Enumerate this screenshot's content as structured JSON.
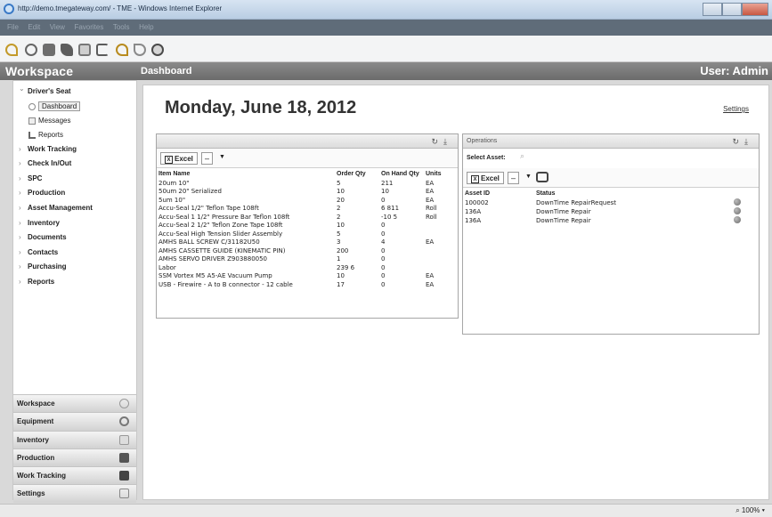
{
  "browser": {
    "title": "http://demo.tmegateway.com/ - TME - Windows Internet Explorer",
    "menu": [
      "File",
      "Edit",
      "View",
      "Favorites",
      "Tools",
      "Help"
    ],
    "zoom": "100%"
  },
  "header": {
    "workspace": "Workspace",
    "page": "Dashboard",
    "user": "User: Admin"
  },
  "sidebar": {
    "tree": [
      {
        "label": "Driver's Seat",
        "open": true,
        "children": [
          {
            "label": "Dashboard",
            "selected": true
          },
          {
            "label": "Messages"
          },
          {
            "label": "Reports"
          }
        ]
      },
      {
        "label": "Work Tracking"
      },
      {
        "label": "Check In/Out"
      },
      {
        "label": "SPC"
      },
      {
        "label": "Production"
      },
      {
        "label": "Asset Management"
      },
      {
        "label": "Inventory"
      },
      {
        "label": "Documents"
      },
      {
        "label": "Contacts"
      },
      {
        "label": "Purchasing"
      },
      {
        "label": "Reports"
      }
    ],
    "accordion": [
      "Workspace",
      "Equipment",
      "Inventory",
      "Production",
      "Work Tracking",
      "Settings"
    ]
  },
  "main": {
    "date": "Monday, June 18, 2012",
    "settings_link": "Settings"
  },
  "inventory_panel": {
    "excel_label": "Excel",
    "columns": [
      "Item Name",
      "Order Qty",
      "On Hand Qty",
      "Units"
    ],
    "rows": [
      [
        "20um 10\"",
        "5",
        "211",
        "EA"
      ],
      [
        "50um 20\" Serialized",
        "10",
        "10",
        "EA"
      ],
      [
        "5um 10\"",
        "20",
        "0",
        "EA"
      ],
      [
        "Accu-Seal 1/2\" Teflon Tape 108ft",
        "2",
        "6 811",
        "Roll"
      ],
      [
        "Accu-Seal 1 1/2\" Pressure Bar Teflon 108ft",
        "2",
        "-10 5",
        "Roll"
      ],
      [
        "Accu-Seal 2 1/2\" Teflon Zone Tape 108ft",
        "10",
        "0",
        ""
      ],
      [
        "Accu-Seal High Tension Slider Assembly",
        "5",
        "0",
        ""
      ],
      [
        "AMHS BALL SCREW C/31182U50",
        "3",
        "4",
        "EA"
      ],
      [
        "AMHS CASSETTE GUIDE (KINEMATIC PIN)",
        "200",
        "0",
        ""
      ],
      [
        "AMHS SERVO DRIVER Z903880050",
        "1",
        "0",
        ""
      ],
      [
        "Labor",
        "239 6",
        "0",
        ""
      ],
      [
        "SSM Vortex M5 A5-AE Vacuum Pump",
        "10",
        "0",
        "EA"
      ],
      [
        "USB - Firewire - A to B connector - 12 cable",
        "17",
        "0",
        "EA"
      ]
    ]
  },
  "operations_panel": {
    "title": "Operations",
    "select_asset_label": "Select Asset:",
    "excel_label": "Excel",
    "columns": [
      "Asset ID",
      "Status"
    ],
    "rows": [
      [
        "100002",
        "DownTime RepairRequest"
      ],
      [
        "136A",
        "DownTime Repair"
      ],
      [
        "136A",
        "DownTime Repair"
      ]
    ]
  }
}
